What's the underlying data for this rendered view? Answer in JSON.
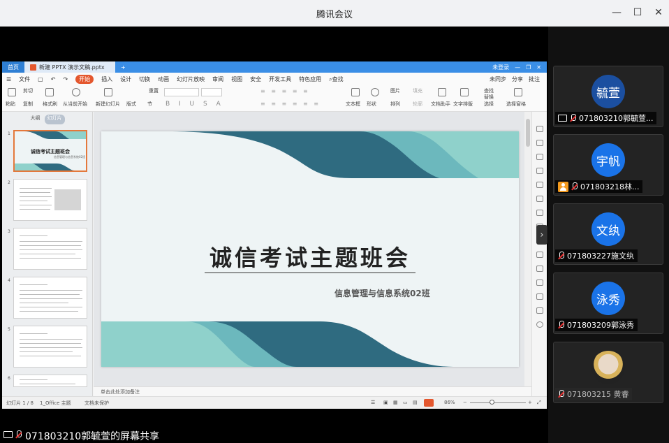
{
  "window": {
    "title": "腾讯会议",
    "minimize": "—",
    "maximize": "☐",
    "close": "✕"
  },
  "wps": {
    "tabs": {
      "home": "首页",
      "doc": "新建 PPTX 演示文稿.pptx",
      "add": "+"
    },
    "topright": {
      "login": "未登录"
    },
    "menu": {
      "file": "文件",
      "start": "开始",
      "items": [
        "插入",
        "设计",
        "切换",
        "动画",
        "幻灯片放映",
        "审阅",
        "视图",
        "安全",
        "开发工具",
        "特色应用"
      ],
      "search": "查找",
      "right": [
        "未同步",
        "分享",
        "批注"
      ]
    },
    "ribbon": {
      "paste": "粘贴",
      "cut": "剪切",
      "copy": "复制",
      "format_painter": "格式刷",
      "from_current": "从当前开始",
      "new_slide": "新建幻灯片",
      "layout": "版式",
      "section": "节",
      "reset": "重置",
      "textbox": "文本框",
      "shape": "形状",
      "image": "图片",
      "arrange": "排列",
      "fill": "填充",
      "outline": "轮廓",
      "text_tools": "文档助手",
      "arttext": "文字排版",
      "find": "查找",
      "replace": "替换",
      "select": "选择",
      "pane": "选择窗格"
    },
    "panel": {
      "outline": "大纲",
      "slides": "幻灯片",
      "add": "+"
    },
    "thumb_nums": [
      "1",
      "2",
      "3",
      "4",
      "5",
      "6"
    ],
    "thumb1": {
      "title": "诚信考试主题班会",
      "sub": "信息管理与信息系统02班"
    },
    "slide": {
      "title": "诚信考试主题班会",
      "subtitle": "信息管理与信息系统02班"
    },
    "notes": "单击此处添加备注",
    "status": {
      "slide_count": "幻灯片 1 / 8",
      "theme": "1_Office 主题",
      "backup": "文档未保护",
      "zoom": "86%",
      "minus": "−",
      "plus": "+"
    }
  },
  "share": {
    "text": "071803210郭毓萱的屏幕共享"
  },
  "participants": [
    {
      "avatar": "毓萱",
      "name": "071803210郭毓萱..."
    },
    {
      "avatar": "宇帆",
      "name": "071803218林..."
    },
    {
      "avatar": "文纨",
      "name": "071803227施文纨"
    },
    {
      "avatar": "泳秀",
      "name": "071803209郭泳秀"
    },
    {
      "avatar": "",
      "name": "071803215 黄睿"
    }
  ],
  "colors": {
    "dark_teal": "#2f6b80",
    "mid_teal": "#6cb8bd",
    "light_teal": "#8fd1cb",
    "accent": "#e4572e",
    "wps_blue": "#3a8ee6"
  }
}
